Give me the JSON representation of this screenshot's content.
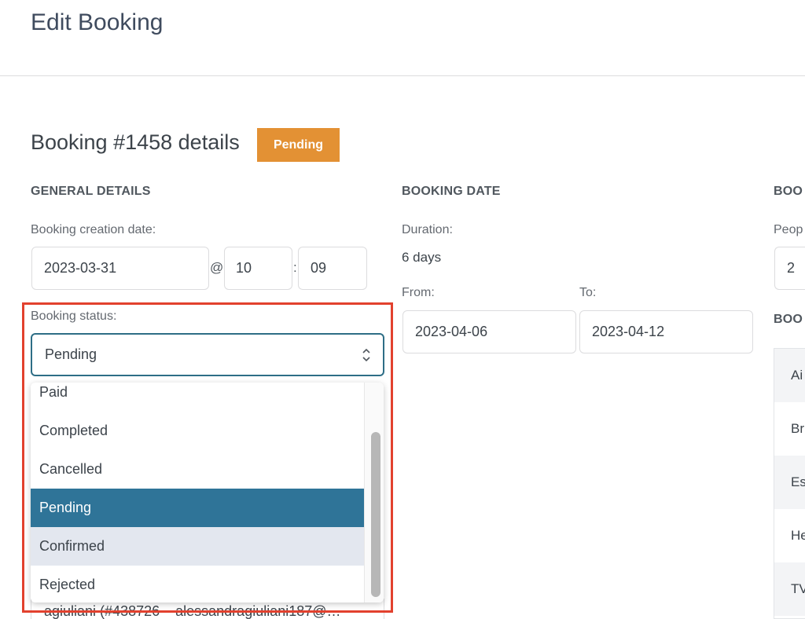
{
  "page": {
    "title": "Edit Booking"
  },
  "booking": {
    "heading": "Booking #1458 details",
    "badge": "Pending"
  },
  "sections": {
    "general": "GENERAL DETAILS",
    "date": "BOOKING DATE",
    "people_cut": "BOO",
    "second_cut": "BOO"
  },
  "general": {
    "creation_label": "Booking creation date:",
    "date": "2023-03-31",
    "at": "@",
    "hour": "10",
    "colon": ":",
    "minute": "09",
    "status_label": "Booking status:",
    "status_selected": "Pending",
    "status_options": [
      "Paid",
      "Completed",
      "Cancelled",
      "Pending",
      "Confirmed",
      "Rejected"
    ],
    "customer_partial": "agiuliani (#438726 – alessandragiuliani187@…"
  },
  "dates": {
    "duration_label": "Duration:",
    "duration_value": "6 days",
    "from_label": "From:",
    "from_value": "2023-04-06",
    "to_label": "To:",
    "to_value": "2023-04-12"
  },
  "people": {
    "label_cut": "Peop",
    "value": "2"
  },
  "right_list": [
    "Ai",
    "Br",
    "Es",
    "He",
    "TV"
  ],
  "colors": {
    "badge": "#e39134",
    "selected_option": "#2f7498",
    "highlight": "#e2412e"
  }
}
